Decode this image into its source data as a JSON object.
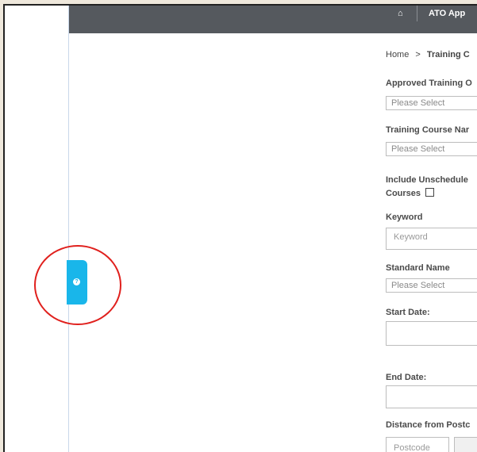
{
  "topbar": {
    "home_icon": "home-icon",
    "nav_label": "ATO App"
  },
  "help_tab": {
    "icon": "question-icon",
    "glyph": "?"
  },
  "breadcrumb": {
    "home": "Home",
    "separator": ">",
    "current": "Training C"
  },
  "form": {
    "ato_label": "Approved Training O",
    "ato_placeholder": "Please Select",
    "course_label": "Training Course Nar",
    "course_placeholder": "Please Select",
    "unscheduled_label_line1": "Include Unschedule",
    "unscheduled_label_line2": "Courses",
    "keyword_label": "Keyword",
    "keyword_placeholder": "Keyword",
    "standard_label": "Standard Name",
    "standard_placeholder": "Please Select",
    "start_label": "Start Date:",
    "end_label": "End Date:",
    "distance_label": "Distance from Postc",
    "postcode_placeholder": "Postcode"
  },
  "colors": {
    "topbar": "#55595e",
    "help_tab": "#19b6ea",
    "callout": "#e0201d"
  }
}
